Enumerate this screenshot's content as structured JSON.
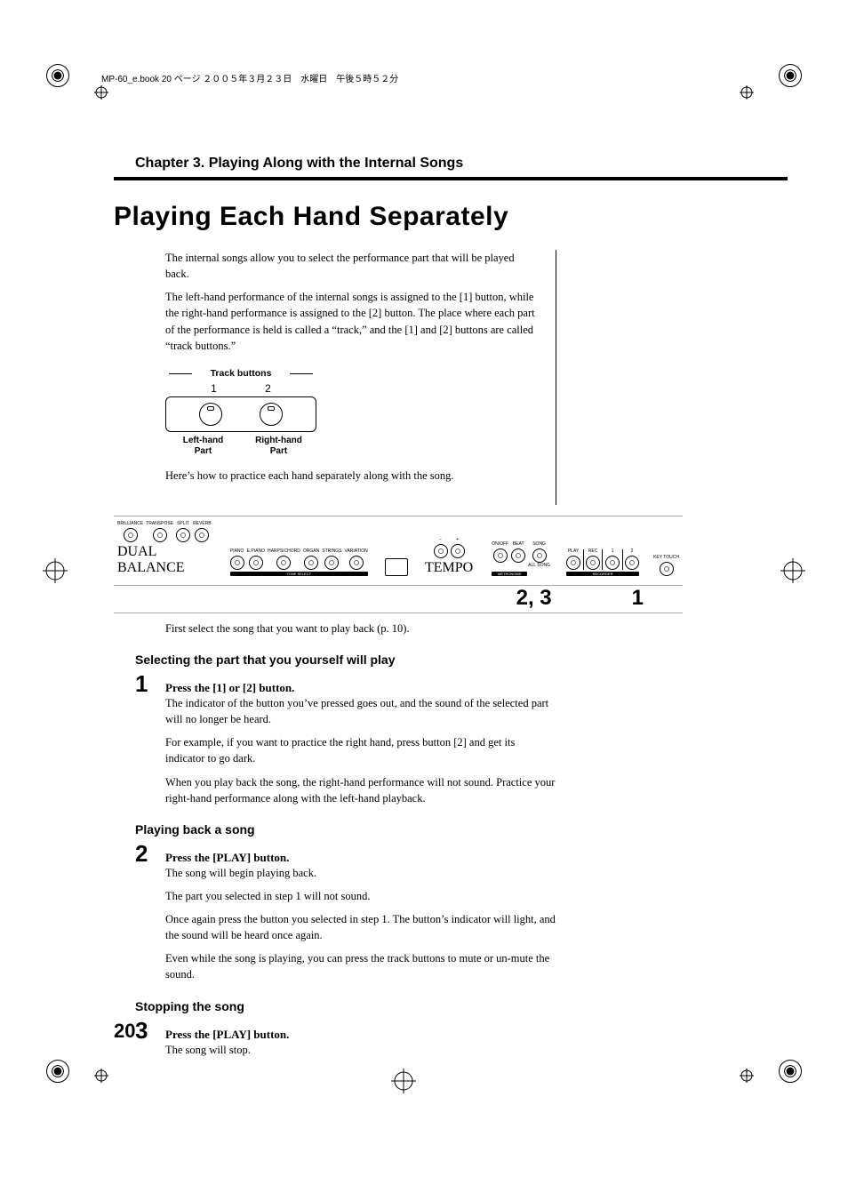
{
  "meta": {
    "book_line": "MP-60_e.book  20 ページ  ２００５年３月２３日　水曜日　午後５時５２分"
  },
  "chapter": "Chapter 3. Playing Along with the Internal Songs",
  "title": "Playing Each Hand Separately",
  "intro": {
    "p1": "The internal songs allow you to select the performance part that will be played back.",
    "p2": "The left-hand performance of the internal songs is assigned to the [1] button, while the right-hand performance is assigned to the [2] button. The place where each part of the performance is held is called a “track,” and the [1] and [2] buttons are called “track buttons.”",
    "p3": "Here’s how to practice each hand separately along with the song."
  },
  "track_fig": {
    "top": "Track buttons",
    "n1": "1",
    "n2": "2",
    "l1a": "Left-hand",
    "l1b": "Part",
    "l2a": "Right-hand",
    "l2b": "Part"
  },
  "panel": {
    "labels": {
      "brilliance": "BRILLIANCE",
      "transpose": "TRANSPOSE",
      "split": "SPLIT",
      "reverb": "REVERB",
      "piano": "PIANO",
      "epiano": "E.PIANO",
      "harpsi": "HARPSICHORD",
      "organ": "ORGAN",
      "strings": "STRINGS",
      "variation": "VARIATION",
      "minus": "−",
      "plus": "+",
      "onoff": "ON/OFF",
      "beat": "BEAT",
      "song": "SONG",
      "play": "PLAY",
      "rec": "REC",
      "t1": "1",
      "t2": "2",
      "keytouch": "KEY TOUCH",
      "dual_balance": "DUAL BALANCE",
      "tone_select": "TONE SELECT",
      "metronome": "METRONOME",
      "tempo_lbl": "TEMPO",
      "all_song": "ALL SONG",
      "recorder": "RECORDER"
    },
    "callout23": "2, 3",
    "callout1": "1"
  },
  "after_panel": "First select the song that you want to play back (p. 10).",
  "sec1": {
    "heading": "Selecting the part that you yourself will play",
    "num": "1",
    "step_title": "Press the [1] or [2] button.",
    "p1": "The indicator of the button you’ve pressed goes out, and the sound of the selected part will no longer be heard.",
    "p2": "For example, if you want to practice the right hand, press button [2] and get its indicator to go dark.",
    "p3": "When you play back the song, the right-hand performance will not sound. Practice your right-hand performance along with the left-hand playback."
  },
  "sec2": {
    "heading": "Playing back a song",
    "num": "2",
    "step_title": "Press the [PLAY] button.",
    "p1": "The song will begin playing back.",
    "p2": "The part you selected in step 1 will not sound.",
    "p3": "Once again press the button you selected in step 1. The button’s indicator will light, and the sound will be heard once again.",
    "p4": "Even while the song is playing, you can press the track buttons to mute or un-mute the sound."
  },
  "sec3": {
    "heading": "Stopping the song",
    "num": "3",
    "step_title": "Press the [PLAY] button.",
    "p1": "The song will stop."
  },
  "page_number": "20"
}
